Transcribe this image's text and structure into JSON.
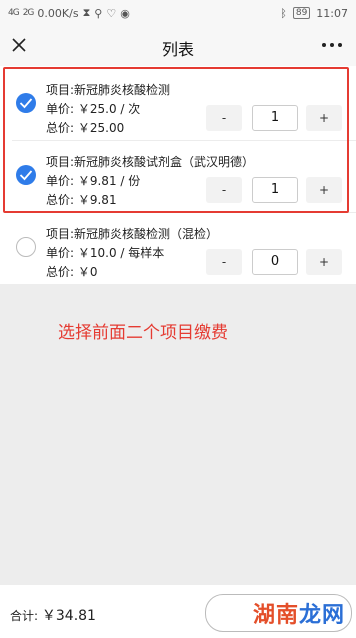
{
  "status_bar": {
    "signal1": "4G",
    "signal2": "2G",
    "speed": "0.00K/s",
    "battery": "89",
    "time": "11:07"
  },
  "nav": {
    "title": "列表"
  },
  "items": [
    {
      "selected": true,
      "title": "项目:新冠肺炎核酸检测",
      "unit_price": "单价: ￥25.0 / 次",
      "total_price": "总价: ￥25.00",
      "minus_label": "-",
      "qty": "1",
      "plus_label": "+"
    },
    {
      "selected": true,
      "title": "项目:新冠肺炎核酸试剂盒（武汉明德）",
      "unit_price": "单价: ￥9.81 / 份",
      "total_price": "总价: ￥9.81",
      "minus_label": "-",
      "qty": "1",
      "plus_label": "+"
    },
    {
      "selected": false,
      "title": "项目:新冠肺炎核酸检测（混检）",
      "unit_price": "单价: ￥10.0 / 每样本",
      "total_price": "总价: ￥0",
      "minus_label": "-",
      "qty": "0",
      "plus_label": "+"
    }
  ],
  "annotation": "选择前面二个项目缴费",
  "footer": {
    "total_label": "合计:",
    "total_amount": "￥34.81"
  },
  "watermark": {
    "text_a": "湖南",
    "text_b": "龙网"
  },
  "colors": {
    "accent": "#2f7ce9",
    "annotation": "#e53b32"
  }
}
